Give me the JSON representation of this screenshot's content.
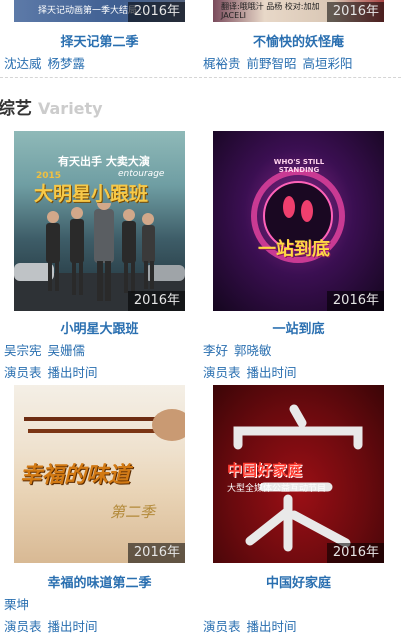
{
  "top_row": [
    {
      "title": "择天记第二季",
      "cast": [
        "沈达威",
        "杨梦露"
      ],
      "year": "2016年",
      "poster_caption": "择天记动画第一季大结局 ..."
    },
    {
      "title": "不愉快的妖怪庵",
      "cast": [
        "梶裕贵",
        "前野智昭",
        "高垣彩阳"
      ],
      "year": "2016年",
      "poster_caption": "翻译:哦哦汁 品杨 校对:加加 JACELI"
    }
  ],
  "section": {
    "title": "综艺",
    "subtitle": "Variety"
  },
  "items": [
    {
      "title": "小明星大跟班",
      "cast": [
        "吴宗宪",
        "吴姗儒"
      ],
      "links": [
        "演员表",
        "播出时间"
      ],
      "year": "2016年",
      "poster_text": {
        "slogan": "有天出手 大卖大演",
        "name": "大明星小跟班",
        "brand": "entourage",
        "year_tag": "2015"
      }
    },
    {
      "title": "一站到底",
      "cast": [
        "李好",
        "郭晓敏"
      ],
      "links": [
        "演员表",
        "播出时间"
      ],
      "year": "2016年",
      "poster_text": {
        "ring": "WHO'S STILL STANDING",
        "name": "一站到底"
      }
    },
    {
      "title": "幸福的味道第二季",
      "cast": [
        "栗坤"
      ],
      "links": [
        "演员表",
        "播出时间"
      ],
      "year": "2016年",
      "poster_text": {
        "name": "幸福的味道",
        "season": "第二季"
      }
    },
    {
      "title": "中国好家庭",
      "cast": [],
      "links": [
        "演员表",
        "播出时间"
      ],
      "year": "2016年",
      "poster_text": {
        "name": "中国好家庭",
        "sub": "大型全媒体公益互动节目"
      }
    }
  ],
  "colors": {
    "link": "#2a6fb0",
    "year_bg": "rgba(0,0,0,0.55)"
  }
}
